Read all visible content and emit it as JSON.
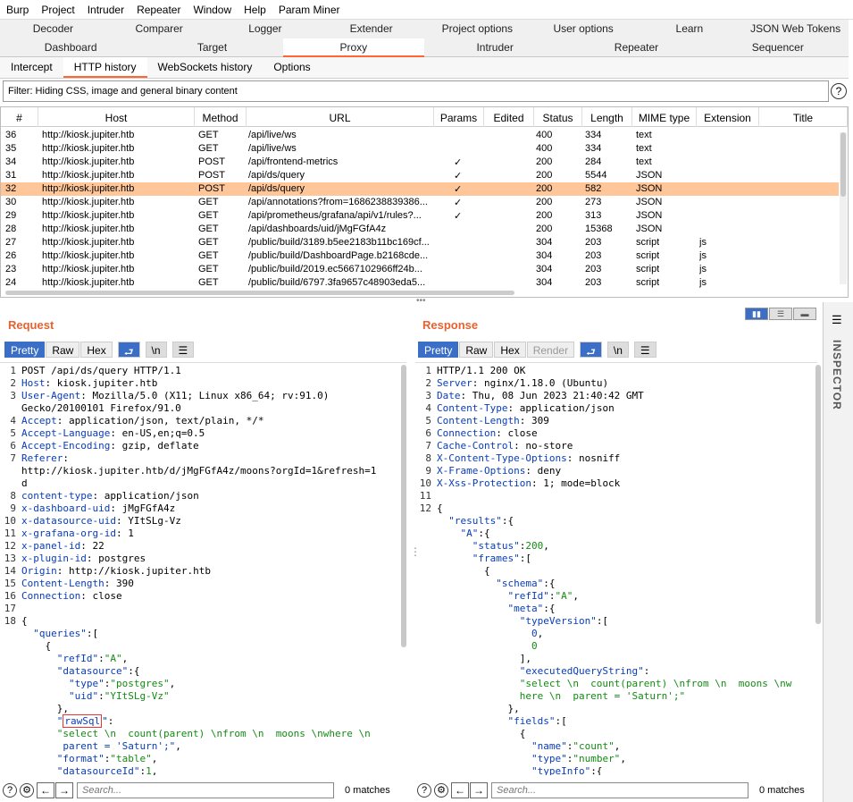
{
  "menu": [
    "Burp",
    "Project",
    "Intruder",
    "Repeater",
    "Window",
    "Help",
    "Param Miner"
  ],
  "tabs_row1": [
    "Decoder",
    "Comparer",
    "Logger",
    "Extender",
    "Project options",
    "User options",
    "Learn",
    "JSON Web Tokens"
  ],
  "tabs_row2": [
    "Dashboard",
    "Target",
    "Proxy",
    "Intruder",
    "Repeater",
    "Sequencer"
  ],
  "subtabs": [
    "Intercept",
    "HTTP history",
    "WebSockets history",
    "Options"
  ],
  "filter": "Filter: Hiding CSS, image and general binary content",
  "help_glyph": "?",
  "columns": [
    "#",
    "Host",
    "Method",
    "URL",
    "Params",
    "Edited",
    "Status",
    "Length",
    "MIME type",
    "Extension",
    "Title"
  ],
  "rows": [
    [
      "36",
      "http://kiosk.jupiter.htb",
      "GET",
      "/api/live/ws",
      "",
      "",
      "400",
      "334",
      "text",
      ""
    ],
    [
      "35",
      "http://kiosk.jupiter.htb",
      "GET",
      "/api/live/ws",
      "",
      "",
      "400",
      "334",
      "text",
      ""
    ],
    [
      "34",
      "http://kiosk.jupiter.htb",
      "POST",
      "/api/frontend-metrics",
      "✓",
      "",
      "200",
      "284",
      "text",
      ""
    ],
    [
      "31",
      "http://kiosk.jupiter.htb",
      "POST",
      "/api/ds/query",
      "✓",
      "",
      "200",
      "5544",
      "JSON",
      ""
    ],
    [
      "32",
      "http://kiosk.jupiter.htb",
      "POST",
      "/api/ds/query",
      "✓",
      "",
      "200",
      "582",
      "JSON",
      ""
    ],
    [
      "30",
      "http://kiosk.jupiter.htb",
      "GET",
      "/api/annotations?from=1686238839386...",
      "✓",
      "",
      "200",
      "273",
      "JSON",
      ""
    ],
    [
      "29",
      "http://kiosk.jupiter.htb",
      "GET",
      "/api/prometheus/grafana/api/v1/rules?...",
      "✓",
      "",
      "200",
      "313",
      "JSON",
      ""
    ],
    [
      "28",
      "http://kiosk.jupiter.htb",
      "GET",
      "/api/dashboards/uid/jMgFGfA4z",
      "",
      "",
      "200",
      "15368",
      "JSON",
      ""
    ],
    [
      "27",
      "http://kiosk.jupiter.htb",
      "GET",
      "/public/build/3189.b5ee2183b11bc169cf...",
      "",
      "",
      "304",
      "203",
      "script",
      "js"
    ],
    [
      "26",
      "http://kiosk.jupiter.htb",
      "GET",
      "/public/build/DashboardPage.b2168cde...",
      "",
      "",
      "304",
      "203",
      "script",
      "js"
    ],
    [
      "23",
      "http://kiosk.jupiter.htb",
      "GET",
      "/public/build/2019.ec5667102966ff24b...",
      "",
      "",
      "304",
      "203",
      "script",
      "js"
    ],
    [
      "24",
      "http://kiosk.jupiter.htb",
      "GET",
      "/public/build/6797.3fa9657c48903eda5...",
      "",
      "",
      "304",
      "203",
      "script",
      "js"
    ]
  ],
  "selected_row": 4,
  "request": {
    "title": "Request",
    "modes": [
      "Pretty",
      "Raw",
      "Hex"
    ],
    "icons": [
      "wrap-icon",
      "newline-icon",
      "menu-icon"
    ],
    "newline_glyph": "\\n"
  },
  "response": {
    "title": "Response",
    "modes": [
      "Pretty",
      "Raw",
      "Hex",
      "Render"
    ],
    "newline_glyph": "\\n"
  },
  "inspector": "INSPECTOR",
  "search_placeholder": "Search...",
  "matches": "0 matches",
  "req_lines": [
    {
      "n": "1",
      "t": [
        [
          "POST /api/ds/query HTTP/1.1",
          ""
        ]
      ]
    },
    {
      "n": "2",
      "t": [
        [
          "Host",
          ""
        ],
        [
          ": kiosk.jupiter.htb",
          ""
        ]
      ]
    },
    {
      "n": "3",
      "t": [
        [
          "User-Agent",
          ""
        ],
        [
          ": Mozilla/5.0 (X11; Linux x86_64; rv:91.0)",
          ""
        ]
      ]
    },
    {
      "n": "",
      "t": [
        [
          "Gecko/20100101 Firefox/91.0",
          ""
        ]
      ]
    },
    {
      "n": "4",
      "t": [
        [
          "Accept",
          ""
        ],
        [
          ": application/json, text/plain, */*",
          ""
        ]
      ]
    },
    {
      "n": "5",
      "t": [
        [
          "Accept-Language",
          ""
        ],
        [
          ": en-US,en;q=0.5",
          ""
        ]
      ]
    },
    {
      "n": "6",
      "t": [
        [
          "Accept-Encoding",
          ""
        ],
        [
          ": gzip, deflate",
          ""
        ]
      ]
    },
    {
      "n": "7",
      "t": [
        [
          "Referer",
          ""
        ],
        [
          ":",
          ""
        ]
      ]
    },
    {
      "n": "",
      "t": [
        [
          "http://kiosk.jupiter.htb/d/jMgFGfA4z/moons?orgId=1&refresh=1",
          ""
        ]
      ]
    },
    {
      "n": "",
      "t": [
        [
          "d",
          ""
        ]
      ]
    },
    {
      "n": "8",
      "t": [
        [
          "content-type",
          ""
        ],
        [
          ": application/json",
          ""
        ]
      ]
    },
    {
      "n": "9",
      "t": [
        [
          "x-dashboard-uid",
          ""
        ],
        [
          ": jMgFGfA4z",
          ""
        ]
      ]
    },
    {
      "n": "10",
      "t": [
        [
          "x-datasource-uid",
          ""
        ],
        [
          ": YItSLg-Vz",
          ""
        ]
      ]
    },
    {
      "n": "11",
      "t": [
        [
          "x-grafana-org-id",
          ""
        ],
        [
          ": 1",
          ""
        ]
      ]
    },
    {
      "n": "12",
      "t": [
        [
          "x-panel-id",
          ""
        ],
        [
          ": 22",
          ""
        ]
      ]
    },
    {
      "n": "13",
      "t": [
        [
          "x-plugin-id",
          ""
        ],
        [
          ": postgres",
          ""
        ]
      ]
    },
    {
      "n": "14",
      "t": [
        [
          "Origin",
          ""
        ],
        [
          ": http://kiosk.jupiter.htb",
          ""
        ]
      ]
    },
    {
      "n": "15",
      "t": [
        [
          "Content-Length",
          ""
        ],
        [
          ": 390",
          ""
        ]
      ]
    },
    {
      "n": "16",
      "t": [
        [
          "Connection",
          ""
        ],
        [
          ": close",
          ""
        ]
      ]
    },
    {
      "n": "17",
      "t": [
        [
          "",
          ""
        ]
      ]
    },
    {
      "n": "18",
      "t": [
        [
          "{",
          ""
        ]
      ]
    },
    {
      "n": "",
      "t": [
        [
          "  \"queries\"",
          ""
        ],
        [
          ":[",
          ""
        ]
      ]
    },
    {
      "n": "",
      "t": [
        [
          "    {",
          ""
        ]
      ]
    },
    {
      "n": "",
      "t": [
        [
          "      \"refId\"",
          ""
        ],
        [
          ":",
          ""
        ],
        [
          "\"A\"",
          ""
        ],
        [
          ",",
          ""
        ]
      ]
    },
    {
      "n": "",
      "t": [
        [
          "      \"datasource\"",
          ""
        ],
        [
          ":{",
          ""
        ]
      ]
    },
    {
      "n": "",
      "t": [
        [
          "        \"type\"",
          ""
        ],
        [
          ":",
          ""
        ],
        [
          "\"postgres\"",
          ""
        ],
        [
          ",",
          ""
        ]
      ]
    },
    {
      "n": "",
      "t": [
        [
          "        \"uid\"",
          ""
        ],
        [
          ":",
          ""
        ],
        [
          "\"YItSLg-Vz\"",
          ""
        ]
      ]
    },
    {
      "n": "",
      "t": [
        [
          "      },",
          ""
        ]
      ]
    },
    {
      "n": "",
      "t": [
        [
          "      \"",
          ""
        ],
        [
          "rawSql",
          ""
        ],
        [
          "\"",
          ""
        ],
        [
          ":",
          ""
        ]
      ]
    },
    {
      "n": "",
      "t": [
        [
          "      \"select \\n  count(parent) \\nfrom \\n  moons \\nwhere \\n",
          ""
        ]
      ]
    },
    {
      "n": "",
      "t": [
        [
          "       parent = 'Saturn';\"",
          ""
        ],
        [
          ",",
          ""
        ]
      ]
    },
    {
      "n": "",
      "t": [
        [
          "      \"format\"",
          ""
        ],
        [
          ":",
          ""
        ],
        [
          "\"table\"",
          ""
        ],
        [
          ",",
          ""
        ]
      ]
    },
    {
      "n": "",
      "t": [
        [
          "      \"datasourceId\"",
          ""
        ],
        [
          ":",
          ""
        ],
        [
          "1",
          ""
        ],
        [
          ",",
          ""
        ]
      ]
    }
  ],
  "resp_lines": [
    {
      "n": "1",
      "t": [
        [
          "HTTP/1.1 200 OK",
          ""
        ]
      ]
    },
    {
      "n": "2",
      "t": [
        [
          "Server",
          ""
        ],
        [
          ": nginx/1.18.0 (Ubuntu)",
          ""
        ]
      ]
    },
    {
      "n": "3",
      "t": [
        [
          "Date",
          ""
        ],
        [
          ": Thu, 08 Jun 2023 21:40:42 GMT",
          ""
        ]
      ]
    },
    {
      "n": "4",
      "t": [
        [
          "Content-Type",
          ""
        ],
        [
          ": application/json",
          ""
        ]
      ]
    },
    {
      "n": "5",
      "t": [
        [
          "Content-Length",
          ""
        ],
        [
          ": 309",
          ""
        ]
      ]
    },
    {
      "n": "6",
      "t": [
        [
          "Connection",
          ""
        ],
        [
          ": close",
          ""
        ]
      ]
    },
    {
      "n": "7",
      "t": [
        [
          "Cache-Control",
          ""
        ],
        [
          ": no-store",
          ""
        ]
      ]
    },
    {
      "n": "8",
      "t": [
        [
          "X-Content-Type-Options",
          ""
        ],
        [
          ": nosniff",
          ""
        ]
      ]
    },
    {
      "n": "9",
      "t": [
        [
          "X-Frame-Options",
          ""
        ],
        [
          ": deny",
          ""
        ]
      ]
    },
    {
      "n": "10",
      "t": [
        [
          "X-Xss-Protection",
          ""
        ],
        [
          ": 1; mode=block",
          ""
        ]
      ]
    },
    {
      "n": "11",
      "t": [
        [
          "",
          ""
        ]
      ]
    },
    {
      "n": "12",
      "t": [
        [
          "{",
          ""
        ]
      ]
    },
    {
      "n": "",
      "t": [
        [
          "  \"results\"",
          ""
        ],
        [
          ":{",
          ""
        ]
      ]
    },
    {
      "n": "",
      "t": [
        [
          "    \"A\"",
          ""
        ],
        [
          ":{",
          ""
        ]
      ]
    },
    {
      "n": "",
      "t": [
        [
          "      \"status\"",
          ""
        ],
        [
          ":",
          ""
        ],
        [
          "200",
          ""
        ],
        [
          ",",
          ""
        ]
      ]
    },
    {
      "n": "",
      "t": [
        [
          "      \"frames\"",
          ""
        ],
        [
          ":[",
          ""
        ]
      ]
    },
    {
      "n": "",
      "t": [
        [
          "        {",
          ""
        ]
      ]
    },
    {
      "n": "",
      "t": [
        [
          "          \"schema\"",
          ""
        ],
        [
          ":{",
          ""
        ]
      ]
    },
    {
      "n": "",
      "t": [
        [
          "            \"refId\"",
          ""
        ],
        [
          ":",
          ""
        ],
        [
          "\"A\"",
          ""
        ],
        [
          ",",
          ""
        ]
      ]
    },
    {
      "n": "",
      "t": [
        [
          "            \"meta\"",
          ""
        ],
        [
          ":{",
          ""
        ]
      ]
    },
    {
      "n": "",
      "t": [
        [
          "              \"typeVersion\"",
          ""
        ],
        [
          ":[",
          ""
        ]
      ]
    },
    {
      "n": "",
      "t": [
        [
          "                0",
          ""
        ],
        [
          ",",
          ""
        ]
      ]
    },
    {
      "n": "",
      "t": [
        [
          "                0",
          ""
        ]
      ]
    },
    {
      "n": "",
      "t": [
        [
          "              ],",
          ""
        ]
      ]
    },
    {
      "n": "",
      "t": [
        [
          "              \"executedQueryString\"",
          ""
        ],
        [
          ":",
          ""
        ]
      ]
    },
    {
      "n": "",
      "t": [
        [
          "              \"select \\n  count(parent) \\nfrom \\n  moons \\nw",
          ""
        ]
      ]
    },
    {
      "n": "",
      "t": [
        [
          "              here \\n  parent = 'Saturn';\"",
          ""
        ]
      ]
    },
    {
      "n": "",
      "t": [
        [
          "            },",
          ""
        ]
      ]
    },
    {
      "n": "",
      "t": [
        [
          "            \"fields\"",
          ""
        ],
        [
          ":[",
          ""
        ]
      ]
    },
    {
      "n": "",
      "t": [
        [
          "              {",
          ""
        ]
      ]
    },
    {
      "n": "",
      "t": [
        [
          "                \"name\"",
          ""
        ],
        [
          ":",
          ""
        ],
        [
          "\"count\"",
          ""
        ],
        [
          ",",
          ""
        ]
      ]
    },
    {
      "n": "",
      "t": [
        [
          "                \"type\"",
          ""
        ],
        [
          ":",
          ""
        ],
        [
          "\"number\"",
          ""
        ],
        [
          ",",
          ""
        ]
      ]
    },
    {
      "n": "",
      "t": [
        [
          "                \"typeInfo\"",
          ""
        ],
        [
          ":{",
          ""
        ]
      ]
    }
  ]
}
